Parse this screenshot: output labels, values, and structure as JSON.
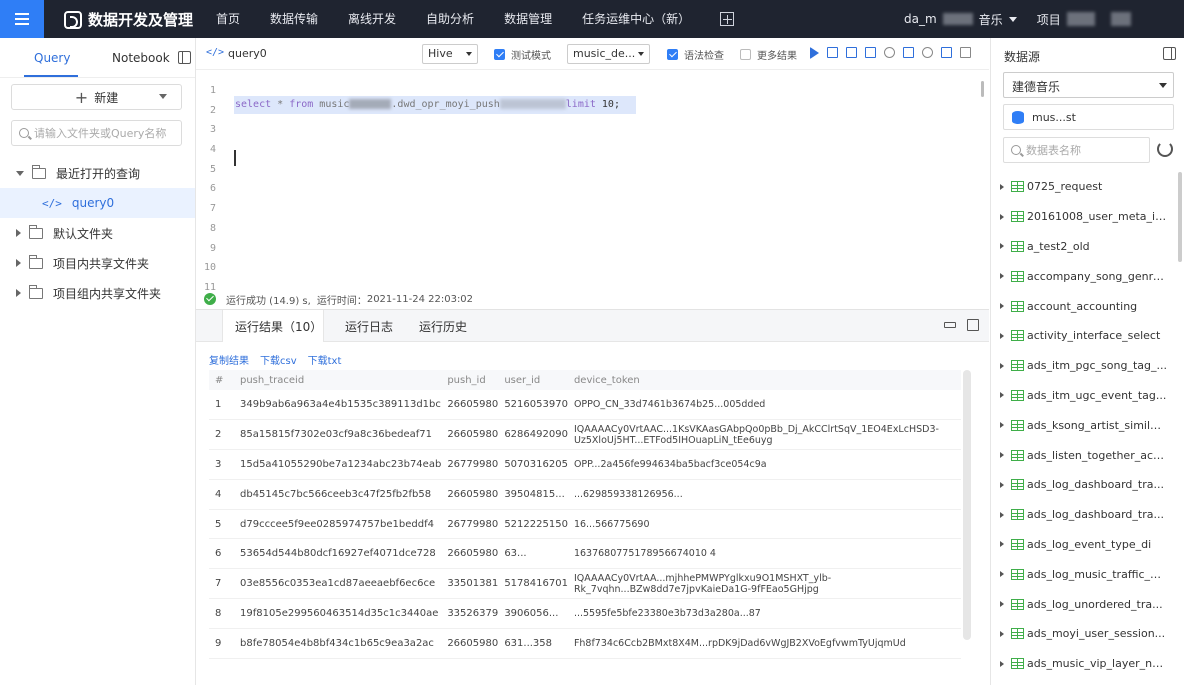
{
  "topbar": {
    "logo_text": "数据开发及管理",
    "nav": [
      "首页",
      "数据传输",
      "离线开发",
      "自助分析",
      "数据管理",
      "任务运维中心（新）"
    ],
    "user_prefix": "da_m",
    "user_project": "音乐",
    "project_label": "项目"
  },
  "left": {
    "tab_query": "Query",
    "tab_notebook": "Notebook",
    "new_label": "新建",
    "search_placeholder": "请输入文件夹或Query名称",
    "tree": {
      "recent": "最近打开的查询",
      "query0": "query0",
      "default_folder": "默认文件夹",
      "project_shared": "项目内共享文件夹",
      "group_shared": "项目组内共享文件夹"
    }
  },
  "editor": {
    "tab_name": "query0",
    "engine": "Hive",
    "test_mode": "测试模式",
    "test_mode_checked": true,
    "db_select": "music_de...",
    "syntax_check": "语法检查",
    "syntax_check_checked": true,
    "more_results": "更多结果",
    "more_results_checked": false,
    "line_numbers": [
      "1",
      "2",
      "3",
      "4",
      "5",
      "6",
      "7",
      "8",
      "9",
      "10",
      "11"
    ],
    "code_kw_select": "select",
    "code_star": " * ",
    "code_kw_from": "from",
    "code_table": " music",
    "code_table2": ".dwd_opr_moyi_push",
    "code_kw_limit": "limit",
    "code_limit_val": " 10;"
  },
  "status": {
    "message": "运行成功 (14.9) s,",
    "time_label": "运行时间：",
    "time_value": "2021-11-24 22:03:02"
  },
  "results": {
    "tabs": [
      "运行结果（10）",
      "运行日志",
      "运行历史"
    ],
    "links": [
      "复制结果",
      "下载csv",
      "下载txt"
    ],
    "columns": [
      "#",
      "push_traceid",
      "push_id",
      "user_id",
      "device_token"
    ],
    "rows": [
      [
        "1",
        "349b9ab6a963a4e4b1535c389113d1bc",
        "26605980",
        "5216053970",
        "OPPO_CN_33d7461b3674b25...005dded"
      ],
      [
        "2",
        "85a15815f7302e03cf9a8c36bedeaf71",
        "26605980",
        "6286492090",
        "IQAAAACy0VrtAAC...1KsVKAasGAbpQo0pBb_Dj_AkCClrtSqV_1EO4ExLcHSD3-Uz5XloUj5HT...ETFod5IHOuapLiN_tEe6uyg"
      ],
      [
        "3",
        "15d5a41055290be7a1234abc23b74eab",
        "26779980",
        "5070316205",
        "OPP...2a456fe994634ba5bacf3ce054c9a"
      ],
      [
        "4",
        "db45145c7bc566ceeb3c47f25fb2fb58",
        "26605980",
        "39504815...",
        "...629859338126956..."
      ],
      [
        "5",
        "d79cccee5f9ee0285974757be1beddf4",
        "26779980",
        "5212225150",
        "16...566775690"
      ],
      [
        "6",
        "53654d544b80dcf16927ef4071dce728",
        "26605980",
        "63...",
        "1637680775178956674010 4"
      ],
      [
        "7",
        "03e8556c0353ea1cd87aeeaebf6ec6ce",
        "33501381",
        "5178416701",
        "IQAAAACy0VrtAA...mjhhePMWPYglkxu9O1MSHXT_ylb-Rk_7vqhn...BZw8dd7e7jpvKaieDa1G-9fFEao5GHjpg"
      ],
      [
        "8",
        "19f8105e299560463514d35c1c3440ae",
        "33526379",
        "3906056...",
        "...5595fe5bfe23380e3b73d3a280a...87"
      ],
      [
        "9",
        "b8fe78054e4b8bf434c1b65c9ea3a2ac",
        "26605980",
        "631...358",
        "Fh8f734c6Ccb2BMxt8X4M...rpDK9jDad6vWgJB2XVoEgfvwmTyUjqmUd"
      ]
    ]
  },
  "right": {
    "title": "数据源",
    "source": "建德音乐",
    "database": "mus...st",
    "search_placeholder": "数据表名称",
    "tables": [
      "0725_request",
      "20161008_user_meta_in...",
      "a_test2_old",
      "accompany_song_genre...",
      "account_accounting",
      "activity_interface_select",
      "ads_itm_pgc_song_tag_...",
      "ads_itm_ugc_event_tag...",
      "ads_ksong_artist_similar...",
      "ads_listen_together_acti...",
      "ads_log_dashboard_tra...",
      "ads_log_dashboard_tra...",
      "ads_log_event_type_di",
      "ads_log_music_traffic_fl...",
      "ads_log_unordered_tra...",
      "ads_moyi_user_session...",
      "ads_music_vip_layer_ne..."
    ]
  }
}
